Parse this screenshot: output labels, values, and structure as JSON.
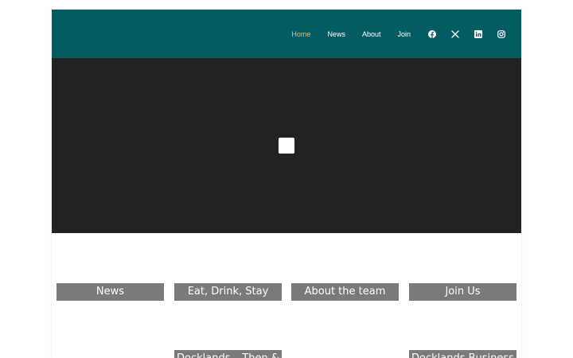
{
  "nav": {
    "items": [
      "Home",
      "News",
      "About",
      "Join"
    ],
    "active": "Home"
  },
  "social": [
    "facebook-icon",
    "x-icon",
    "linkedin-icon",
    "instagram-icon"
  ],
  "colors": {
    "header_bg": "#045c63",
    "nav_active": "#e3c27a",
    "video_bg": "#222222",
    "tile_bg": "#7a7a7a"
  },
  "tiles": {
    "row1": [
      "News",
      "Eat, Drink, Stay",
      "About the team",
      "Join Us"
    ],
    "row2": [
      "Docklands – Then &",
      "Docklands Business"
    ]
  }
}
